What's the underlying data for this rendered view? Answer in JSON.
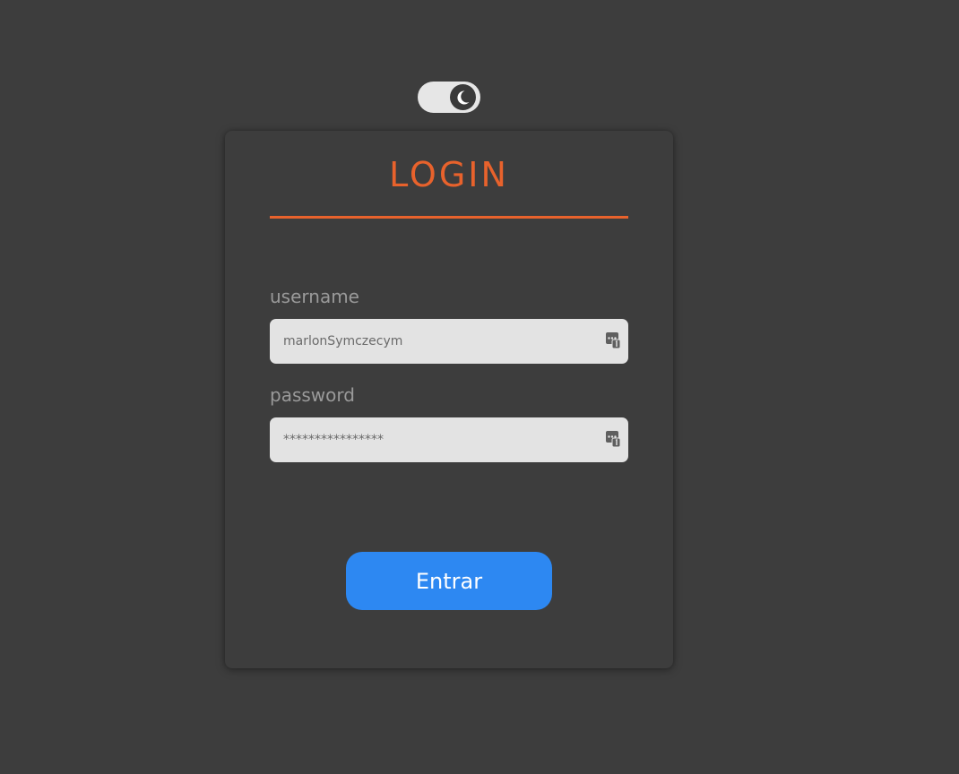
{
  "theme_toggle": {
    "icon": "moon-icon",
    "state": "dark"
  },
  "login": {
    "title": "LOGIN",
    "username": {
      "label": "username",
      "value": "marlonSymczecym",
      "icon": "password-manager-icon"
    },
    "password": {
      "label": "password",
      "value": "****************",
      "icon": "password-manager-icon"
    },
    "submit_label": "Entrar"
  },
  "colors": {
    "background": "#3d3d3d",
    "accent": "#e8622c",
    "button": "#2d88f2",
    "field": "#e3e3e3",
    "label": "#9a9a9a"
  }
}
